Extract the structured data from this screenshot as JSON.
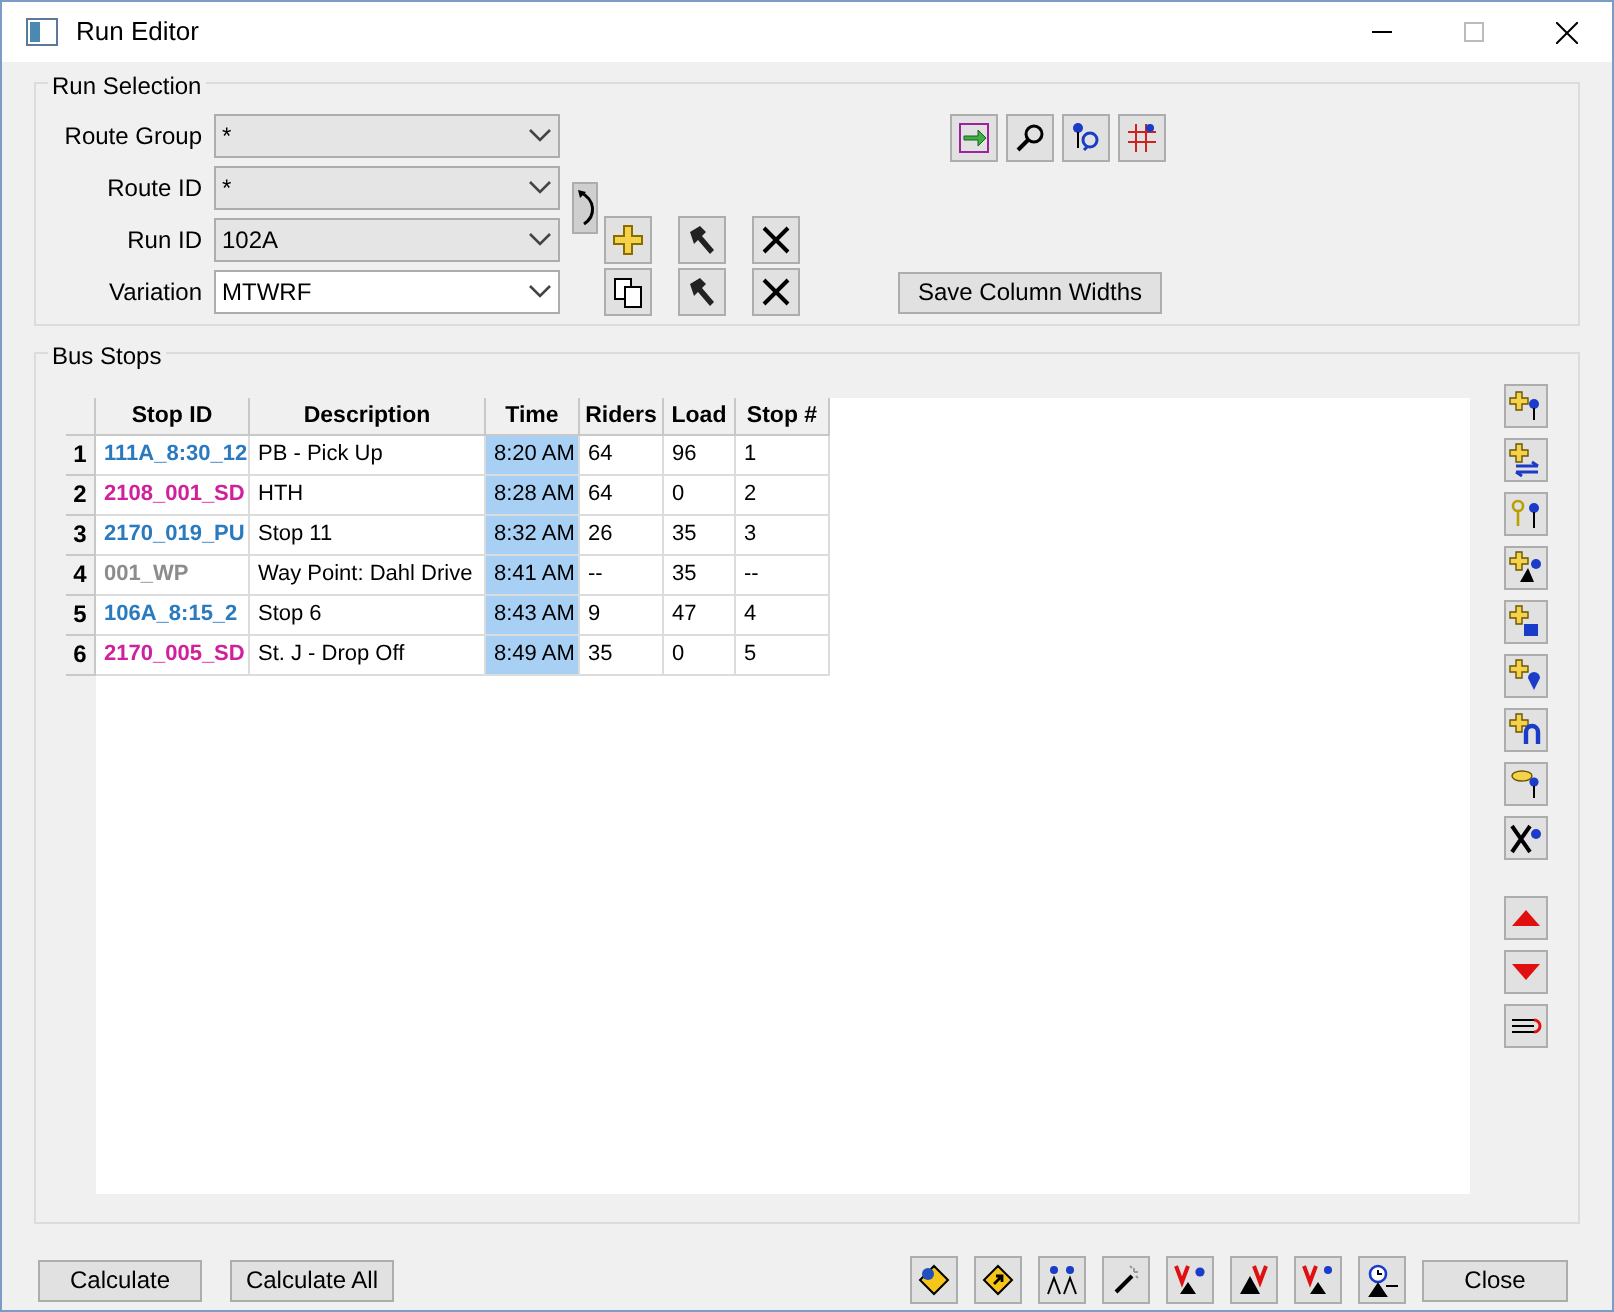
{
  "window": {
    "title": "Run Editor"
  },
  "run_selection": {
    "title": "Run Selection",
    "fields": [
      {
        "label": "Route Group",
        "value": "*",
        "editable": false
      },
      {
        "label": "Route ID",
        "value": "*",
        "editable": false
      },
      {
        "label": "Run ID",
        "value": "102A",
        "editable": false
      },
      {
        "label": "Variation",
        "value": "MTWRF",
        "editable": true
      }
    ],
    "save_button": "Save Column Widths"
  },
  "bus_stops": {
    "title": "Bus Stops",
    "columns": [
      "Stop ID",
      "Description",
      "Time",
      "Riders",
      "Load",
      "Stop #"
    ],
    "rows": [
      {
        "index": "1",
        "stop_id": "111A_8:30_12",
        "color": "#2a7ac0",
        "description": "PB - Pick Up",
        "time": "8:20 AM",
        "riders": "64",
        "load": "96",
        "stop_no": "1"
      },
      {
        "index": "2",
        "stop_id": "2108_001_SD",
        "color": "#d0209c",
        "description": "HTH",
        "time": "8:28 AM",
        "riders": "64",
        "load": "0",
        "stop_no": "2"
      },
      {
        "index": "3",
        "stop_id": "2170_019_PU",
        "color": "#2a7ac0",
        "description": "Stop 11",
        "time": "8:32 AM",
        "riders": "26",
        "load": "35",
        "stop_no": "3"
      },
      {
        "index": "4",
        "stop_id": "001_WP",
        "color": "#8c8c8c",
        "description": "Way Point: Dahl Drive",
        "time": "8:41 AM",
        "riders": "--",
        "load": "35",
        "stop_no": "--"
      },
      {
        "index": "5",
        "stop_id": "106A_8:15_2",
        "color": "#2a7ac0",
        "description": "Stop 6",
        "time": "8:43 AM",
        "riders": "9",
        "load": "47",
        "stop_no": "4"
      },
      {
        "index": "6",
        "stop_id": "2170_005_SD",
        "color": "#d0209c",
        "description": "St. J - Drop Off",
        "time": "8:49 AM",
        "riders": "35",
        "load": "0",
        "stop_no": "5"
      }
    ]
  },
  "footer": {
    "buttons": [
      "Calculate",
      "Calculate All"
    ],
    "close": "Close"
  }
}
